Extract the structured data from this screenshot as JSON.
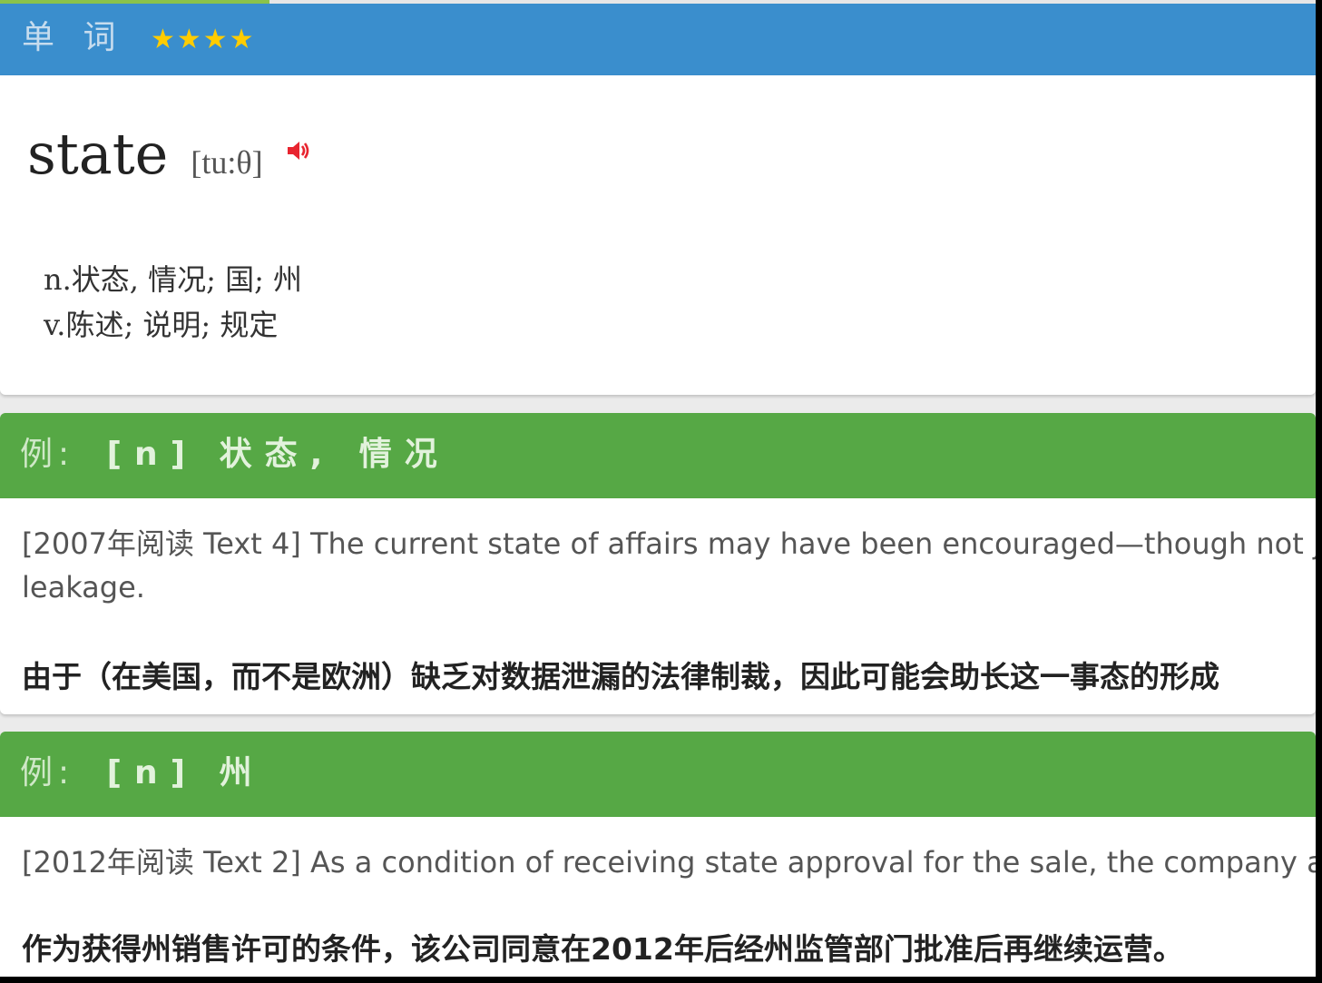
{
  "header": {
    "title": "单 词",
    "stars": "★★★★"
  },
  "word": {
    "headword": "state",
    "phonetic": "[tu:θ]",
    "audio_icon": "speaker-icon",
    "definitions": [
      "n.状态, 情况; 国; 州",
      "v.陈述; 说明; 规定"
    ]
  },
  "examples": [
    {
      "label": "例:",
      "pos": "[n]",
      "meaning": "状态, 情况",
      "english": "[2007年阅读 Text 4] The current state of affairs may have been encouraged—though not j leakage.",
      "english_line1": "[2007年阅读 Text 4] The current state of affairs may have been encouraged—though not j",
      "english_line2": "leakage.",
      "chinese": "由于（在美国，而不是欧洲）缺乏对数据泄漏的法律制裁，因此可能会助长这一事态的形成"
    },
    {
      "label": "例:",
      "pos": "[n]",
      "meaning": "州",
      "english": "[2012年阅读 Text 2] As a condition of receiving state approval for the sale, the company a",
      "chinese": "作为获得州销售许可的条件，该公司同意在2012年后经州监管部门批准后再继续运营。"
    }
  ],
  "colors": {
    "header_blue": "#3a8ecd",
    "example_green": "#56a845",
    "star_yellow": "#ffcc00",
    "audio_red": "#e8242f"
  }
}
